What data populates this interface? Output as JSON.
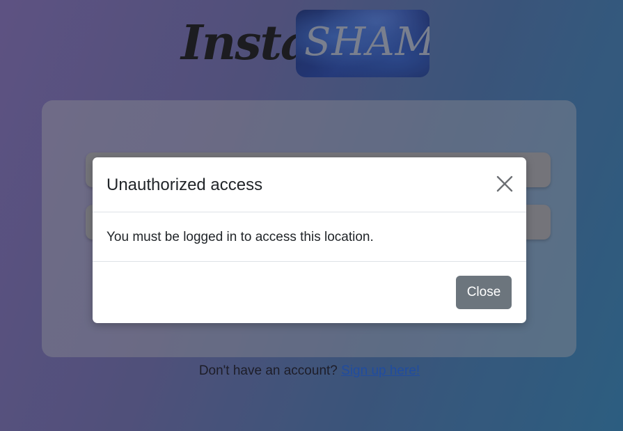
{
  "logo": {
    "part1": "Insta",
    "part2": "SHAM"
  },
  "signup": {
    "prompt": "Don't have an account?",
    "link_label": "Sign up here!"
  },
  "modal": {
    "title": "Unauthorized access",
    "close_icon": "close-icon",
    "body": "You must be logged in to access this location.",
    "close_button_label": "Close"
  },
  "colors": {
    "close_button": "#6c757d",
    "link": "#1f55b6",
    "modal_background": "#ffffff"
  }
}
